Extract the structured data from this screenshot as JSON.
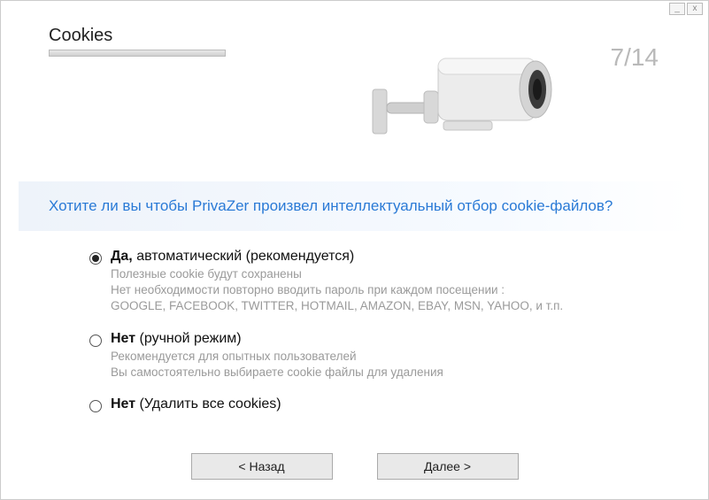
{
  "window": {
    "minimize": "_",
    "close": "x"
  },
  "header": {
    "title": "Cookies",
    "step": "7/14"
  },
  "question": "Хотите ли вы чтобы PrivaZer произвел интеллектуальный отбор cookie-файлов?",
  "options": [
    {
      "checked": true,
      "bold": "Да,",
      "rest": " автоматический (рекомендуется)",
      "desc": [
        "Полезные cookie будут сохранены",
        "Нет необходимости повторно вводить пароль при каждом посещении :",
        "GOOGLE, FACEBOOK, TWITTER, HOTMAIL, AMAZON, EBAY, MSN, YAHOO, и т.п."
      ]
    },
    {
      "checked": false,
      "bold": "Нет",
      "rest": " (ручной режим)",
      "desc": [
        "Рекомендуется для опытных пользователей",
        "Вы самостоятельно выбираете cookie файлы для удаления"
      ]
    },
    {
      "checked": false,
      "bold": "Нет",
      "rest": " (Удалить все cookies)",
      "desc": []
    }
  ],
  "buttons": {
    "back": "< Назад",
    "next": "Далее >"
  }
}
